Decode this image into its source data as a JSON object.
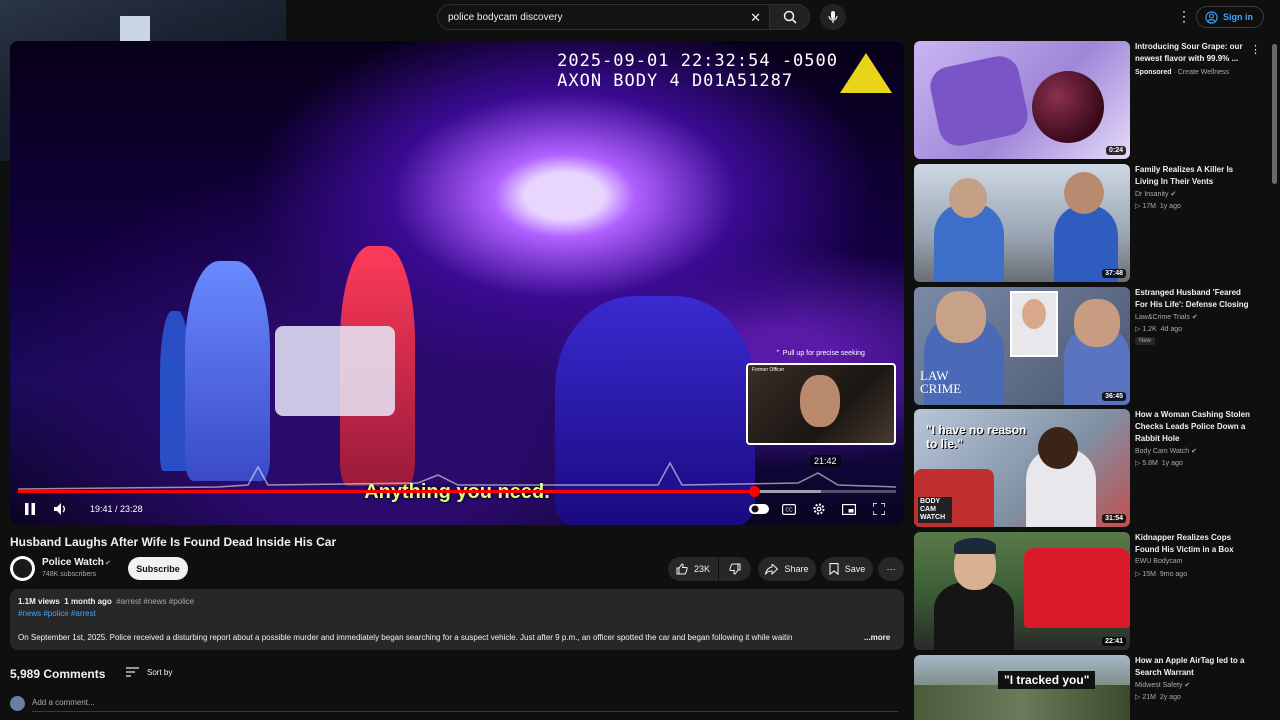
{
  "search": {
    "query": "police bodycam discovery"
  },
  "header": {
    "signin_label": "Sign in"
  },
  "player": {
    "timestamp_line1": "2025-09-01 22:32:54 -0500",
    "timestamp_line2": "AXON BODY 4 D01A51287",
    "caption": "Anything you need.",
    "scrub_hint": "⌃ Pull up for precise seeking",
    "preview_tag": "Former Officer",
    "preview_time": "21:42",
    "current_time": "19:41",
    "duration": "23:28",
    "progress_fraction": 0.838,
    "buffered_fraction": 0.915
  },
  "video": {
    "title": "Husband Laughs After Wife Is Found Dead Inside His Car",
    "channel": "Police Watch",
    "subscribers": "748K subscribers",
    "subscribe_label": "Subscribe",
    "likes": "23K",
    "share_label": "Share",
    "save_label": "Save"
  },
  "description": {
    "views": "1.1M views",
    "age": "1 month ago",
    "hashtags_inline": "#arrest #news #police",
    "tags": "#news #police #arrest",
    "text": "On September 1st, 2025. Police received a disturbing report about a possible murder and immediately began searching for a suspect vehicle. Just after 9 p.m., an officer spotted the car and began following it while waitin",
    "more_label": "...more"
  },
  "comments": {
    "count": "5,989 Comments",
    "sort_label": "Sort by",
    "placeholder": "Add a comment..."
  },
  "recommendations": [
    {
      "title": "Introducing Sour Grape: our newest flavor with 99.9% ...",
      "sponsored_label": "Sponsored",
      "channel": "Create Wellness",
      "duration": "0:24"
    },
    {
      "title": "Family Realizes A Killer Is Living In Their Vents",
      "channel": "Dr Insanity",
      "views": "17M",
      "age": "1y ago",
      "duration": "37:48"
    },
    {
      "title": "Estranged Husband 'Feared For His Life': Defense Closing",
      "channel": "Law&Crime Trials",
      "views": "1.2K",
      "age": "4d ago",
      "badge": "New",
      "duration": "36:45"
    },
    {
      "title": "How a Woman Cashing Stolen Checks Leads Police Down a Rabbit Hole",
      "channel": "Body Cam Watch",
      "views": "5.8M",
      "age": "1y ago",
      "duration": "31:54"
    },
    {
      "title": "Kidnapper Realizes Cops Found His Victim in a Box",
      "channel": "EWU Bodycam",
      "views": "15M",
      "age": "9mo ago",
      "duration": "22:41"
    },
    {
      "title": "How an Apple AirTag led to a Search Warrant",
      "channel": "Midwest Safety",
      "views": "21M",
      "age": "2y ago",
      "duration": ""
    }
  ],
  "thumb_text": {
    "t2_law": "LAW",
    "t2_crime": "CRIME",
    "t3_quote": "\"I have no reason to lie.\"",
    "t3_brand": "BODY CAM WATCH",
    "t5_quote": "\"I tracked you\""
  }
}
